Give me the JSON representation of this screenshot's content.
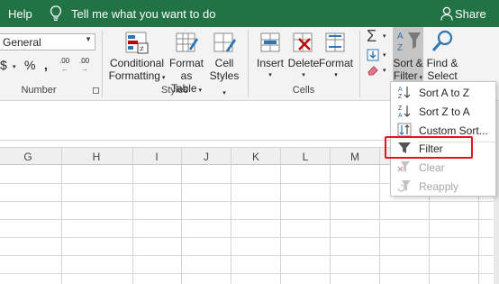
{
  "topbar": {
    "help": "Help",
    "tell_me": "Tell me what you want to do",
    "share": "Share"
  },
  "ribbon": {
    "number_format": "General",
    "currency": "$",
    "percent": "%",
    "comma": ",",
    "inc_decimal": ".00",
    "dec_decimal": ".00",
    "groups": {
      "number": "Number",
      "styles": "Styles",
      "cells": "Cells"
    },
    "styles": {
      "conditional": [
        "Conditional",
        "Formatting"
      ],
      "format_as": [
        "Format as",
        "Table"
      ],
      "cell": [
        "Cell",
        "Styles"
      ]
    },
    "cells": {
      "insert": "Insert",
      "delete": "Delete",
      "format": "Format"
    },
    "editing": {
      "sort": [
        "Sort &",
        "Filter"
      ],
      "find": [
        "Find &",
        "Select"
      ]
    }
  },
  "columns": [
    "G",
    "H",
    "I",
    "J",
    "K",
    "L",
    "M"
  ],
  "menu": {
    "items": [
      {
        "label": "Sort A to Z",
        "icon": "sort-a-to-z-icon",
        "enabled": true
      },
      {
        "label": "Sort Z to A",
        "icon": "sort-z-to-a-icon",
        "enabled": true
      },
      {
        "label": "Custom Sort...",
        "icon": "custom-sort-icon",
        "enabled": true
      },
      {
        "label": "Filter",
        "icon": "filter-icon",
        "enabled": true
      },
      {
        "label": "Clear",
        "icon": "clear-filter-icon",
        "enabled": false
      },
      {
        "label": "Reapply",
        "icon": "reapply-icon",
        "enabled": false
      }
    ]
  },
  "colors": {
    "excel_green": "#217346",
    "highlight_red": "#e8131c"
  }
}
